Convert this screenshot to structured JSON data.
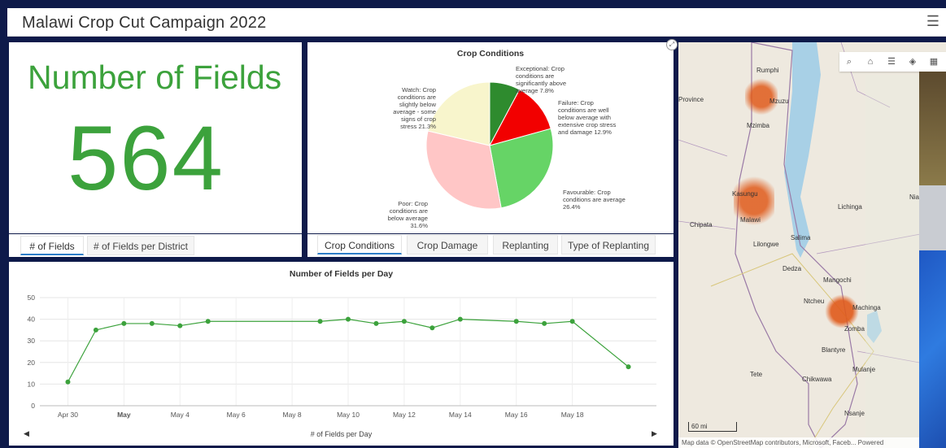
{
  "header": {
    "title": "Malawi Crop Cut Campaign 2022",
    "menu_icon": "hamburger-menu-icon"
  },
  "indicator": {
    "label": "Number of Fields",
    "value": "564"
  },
  "left_tabs": [
    {
      "label": "# of Fields",
      "active": true
    },
    {
      "label": "# of Fields per District",
      "active": false
    }
  ],
  "pie": {
    "title": "Crop Conditions",
    "labels": {
      "exceptional": "Exceptional: Crop conditions are significantly above average 7.8%",
      "failure": "Failure: Crop conditions are well below average with extensive crop stress and damage 12.9%",
      "favourable": "Favourable: Crop conditions are average 26.4%",
      "poor": "Poor: Crop conditions are below average 31.6%",
      "watch": "Watch: Crop conditions are slightly below average - some signs of crop stress 21.3%"
    }
  },
  "right_tabs": [
    {
      "label": "Crop Conditions",
      "active": true
    },
    {
      "label": "Crop Damage",
      "active": false
    },
    {
      "label": "Replanting",
      "active": false
    },
    {
      "label": "Type of Replanting",
      "active": false
    }
  ],
  "line_chart": {
    "footer": "# of Fields per Day"
  },
  "chart_data": [
    {
      "type": "pie",
      "title": "Crop Conditions",
      "slices": [
        {
          "name": "Exceptional",
          "value": 7.8,
          "color": "#2e8b2e"
        },
        {
          "name": "Failure",
          "value": 12.9,
          "color": "#f20000"
        },
        {
          "name": "Favourable",
          "value": 26.4,
          "color": "#66d466"
        },
        {
          "name": "Poor",
          "value": 31.6,
          "color": "#ffc6c6"
        },
        {
          "name": "Watch",
          "value": 21.3,
          "color": "#f8f5cc"
        }
      ]
    },
    {
      "type": "line",
      "title": "Number of Fields per Day",
      "xlabel": "# of Fields per Day",
      "ylabel": "",
      "ylim": [
        0,
        50
      ],
      "yticks": [
        0,
        10,
        20,
        30,
        40,
        50
      ],
      "xtick_labels": [
        "Apr 30",
        "May",
        "May 4",
        "May 6",
        "May 8",
        "May 10",
        "May 12",
        "May 14",
        "May 16",
        "May 18"
      ],
      "x": [
        "2022-04-30",
        "2022-05-01",
        "2022-05-02",
        "2022-05-03",
        "2022-05-04",
        "2022-05-05",
        "2022-05-09",
        "2022-05-10",
        "2022-05-11",
        "2022-05-12",
        "2022-05-13",
        "2022-05-14",
        "2022-05-16",
        "2022-05-17",
        "2022-05-18",
        "2022-05-20"
      ],
      "y": [
        11,
        35,
        38,
        38,
        37,
        39,
        39,
        40,
        38,
        39,
        36,
        40,
        39,
        38,
        39,
        18
      ],
      "color": "#3ca23c",
      "grid": true
    }
  ],
  "map": {
    "places": [
      "Rumphi",
      "Mzuzu",
      "Mzimba",
      "Kasungu",
      "Malawi",
      "Chipata",
      "Lilongwe",
      "Salima",
      "Lichinga",
      "Dedza",
      "Mangochi",
      "Ntcheu",
      "Machinga",
      "Zomba",
      "Tete",
      "Blantyre",
      "Chikwawa",
      "Mulanje",
      "Nsanje",
      "Niassa",
      "Province"
    ],
    "scale": "60 mi",
    "attribution": "Map data © OpenStreetMap contributors, Microsoft, Faceb...  Powered",
    "tools": [
      "search-icon",
      "home-icon",
      "list-icon",
      "layers-icon",
      "qr-icon"
    ]
  }
}
